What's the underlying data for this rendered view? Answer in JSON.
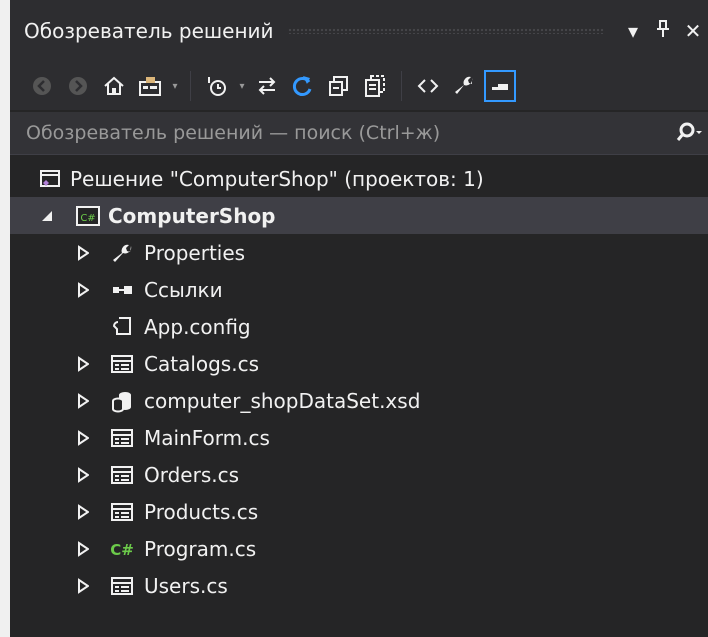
{
  "window": {
    "title": "Обозреватель решений"
  },
  "search": {
    "placeholder": "Обозреватель решений — поиск (Ctrl+ж)"
  },
  "solution": {
    "label": "Решение \"ComputerShop\"  (проектов: 1)"
  },
  "project": {
    "label": "ComputerShop"
  },
  "items": [
    {
      "label": "Properties",
      "icon": "wrench-icon",
      "expandable": true
    },
    {
      "label": "Ссылки",
      "icon": "references-icon",
      "expandable": true
    },
    {
      "label": "App.config",
      "icon": "config-file-icon",
      "expandable": false
    },
    {
      "label": "Catalogs.cs",
      "icon": "form-icon",
      "expandable": true
    },
    {
      "label": "computer_shopDataSet.xsd",
      "icon": "dataset-icon",
      "expandable": true
    },
    {
      "label": "MainForm.cs",
      "icon": "form-icon",
      "expandable": true
    },
    {
      "label": "Orders.cs",
      "icon": "form-icon",
      "expandable": true
    },
    {
      "label": "Products.cs",
      "icon": "form-icon",
      "expandable": true
    },
    {
      "label": "Program.cs",
      "icon": "csharp-file-icon",
      "expandable": true
    },
    {
      "label": "Users.cs",
      "icon": "form-icon",
      "expandable": true
    }
  ],
  "colors": {
    "panel": "#252526",
    "selected": "#3f3f46",
    "accent": "#3399ff",
    "csharp": "#6ccb4a"
  }
}
